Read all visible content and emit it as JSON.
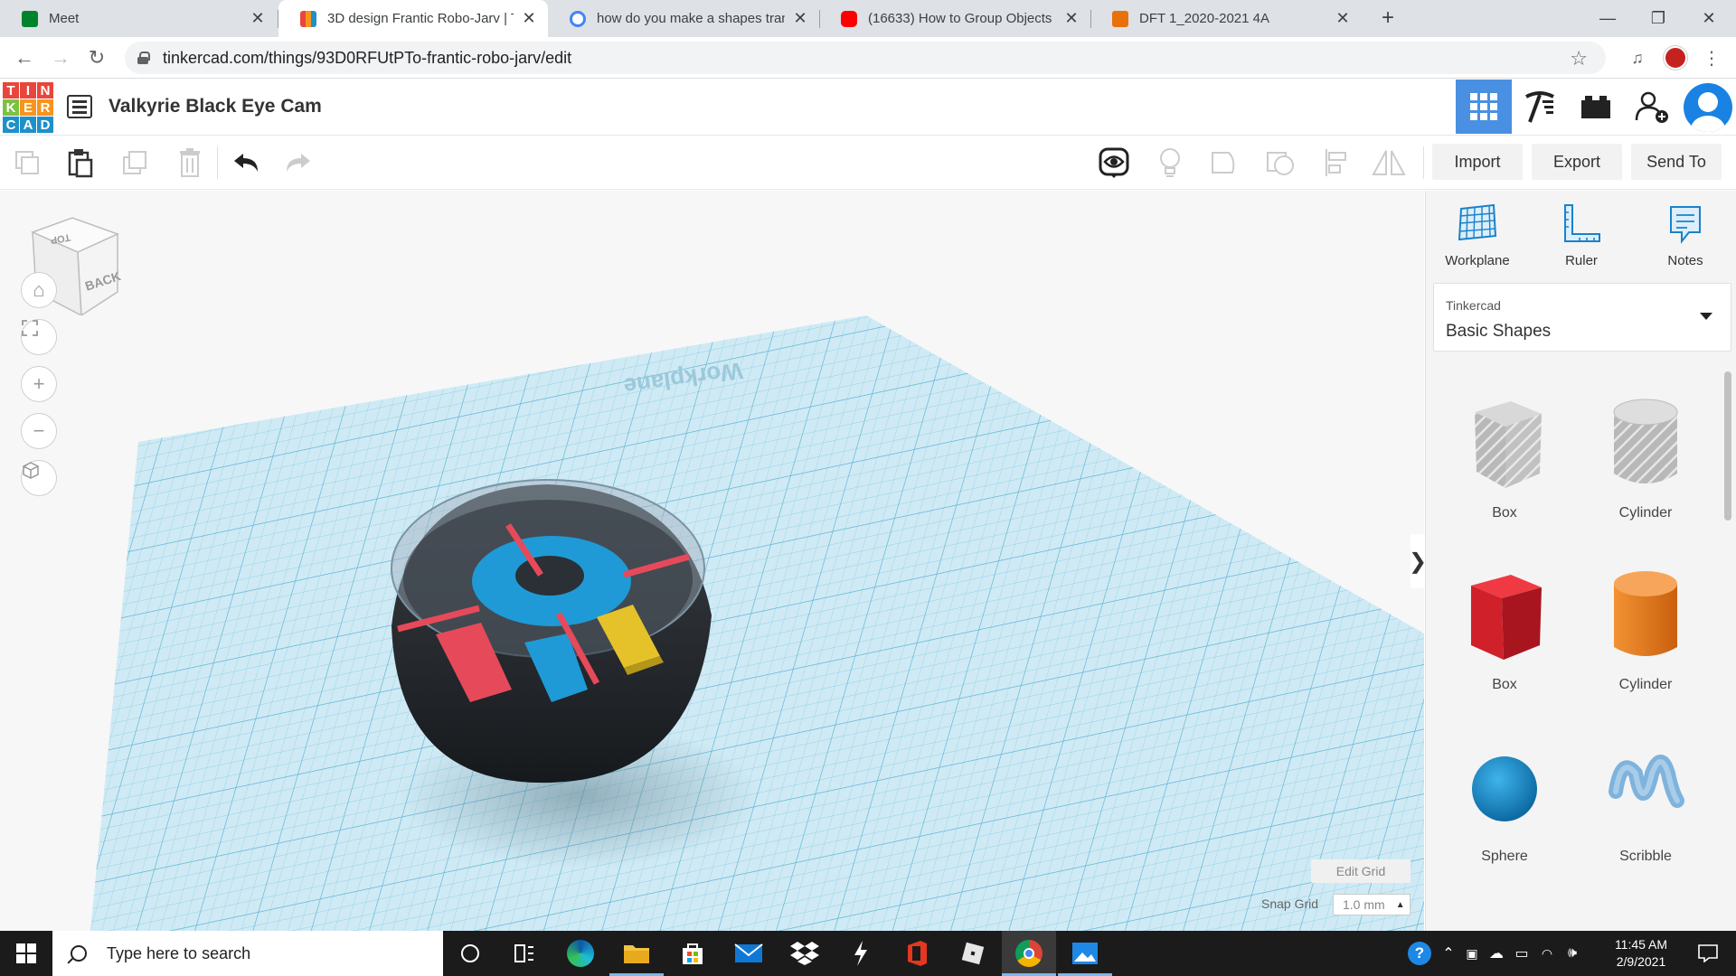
{
  "browser": {
    "tabs": [
      {
        "title": "Meet",
        "favicon_color": "#00832d",
        "active": false
      },
      {
        "title": "3D design Frantic Robo-Jarv | Tin",
        "favicon_color": "#e44d26",
        "active": true
      },
      {
        "title": "how do you make a shapes trans",
        "favicon_color": "#4285f4",
        "active": false
      },
      {
        "title": "(16633) How to Group Objects in",
        "favicon_color": "#ff0000",
        "active": false
      },
      {
        "title": "DFT 1_2020-2021 4A",
        "favicon_color": "#e8710a",
        "active": false
      }
    ],
    "new_tab": "+",
    "window_controls": {
      "minimize": "—",
      "maximize": "❐",
      "close": "✕"
    },
    "url": "tinkercad.com/things/93D0RFUtPTo-frantic-robo-jarv/edit",
    "star": "☆"
  },
  "tinkercad": {
    "logo_letters": [
      "T",
      "I",
      "N",
      "K",
      "E",
      "R",
      "C",
      "A",
      "D"
    ],
    "logo_colors": [
      "#e8463c",
      "#e8463c",
      "#e8463c",
      "#f7941d",
      "#f7941d",
      "#f7941d",
      "#1e90c9",
      "#1e90c9",
      "#1e90c9"
    ],
    "design_title": "Valkyrie Black Eye Cam",
    "accent": "#4a90e2",
    "toolbar": {
      "import_label": "Import",
      "export_label": "Export",
      "send_to_label": "Send To"
    },
    "viewcube": {
      "top_label": "TOP",
      "back_label": "BACK"
    },
    "workplane_watermark": "Workplane",
    "edit_grid_label": "Edit Grid",
    "snap_grid_label": "Snap Grid",
    "snap_grid_value": "1.0 mm",
    "panel": {
      "tools": [
        {
          "label": "Workplane",
          "icon": "workplane-icon"
        },
        {
          "label": "Ruler",
          "icon": "ruler-icon"
        },
        {
          "label": "Notes",
          "icon": "notes-icon"
        }
      ],
      "library_source": "Tinkercad",
      "library_name": "Basic Shapes",
      "shapes": [
        {
          "label": "Box",
          "kind": "box-hole",
          "color": "#b8b8b8"
        },
        {
          "label": "Cylinder",
          "kind": "cylinder-hole",
          "color": "#c4c4c4"
        },
        {
          "label": "Box",
          "kind": "box",
          "color": "#d0202a"
        },
        {
          "label": "Cylinder",
          "kind": "cylinder",
          "color": "#e8761a"
        },
        {
          "label": "Sphere",
          "kind": "sphere",
          "color": "#1a8fd0"
        },
        {
          "label": "Scribble",
          "kind": "scribble",
          "color": "#7fb3dc"
        }
      ]
    }
  },
  "taskbar": {
    "search_placeholder": "Type here to search",
    "time": "11:45 AM",
    "date": "2/9/2021"
  }
}
